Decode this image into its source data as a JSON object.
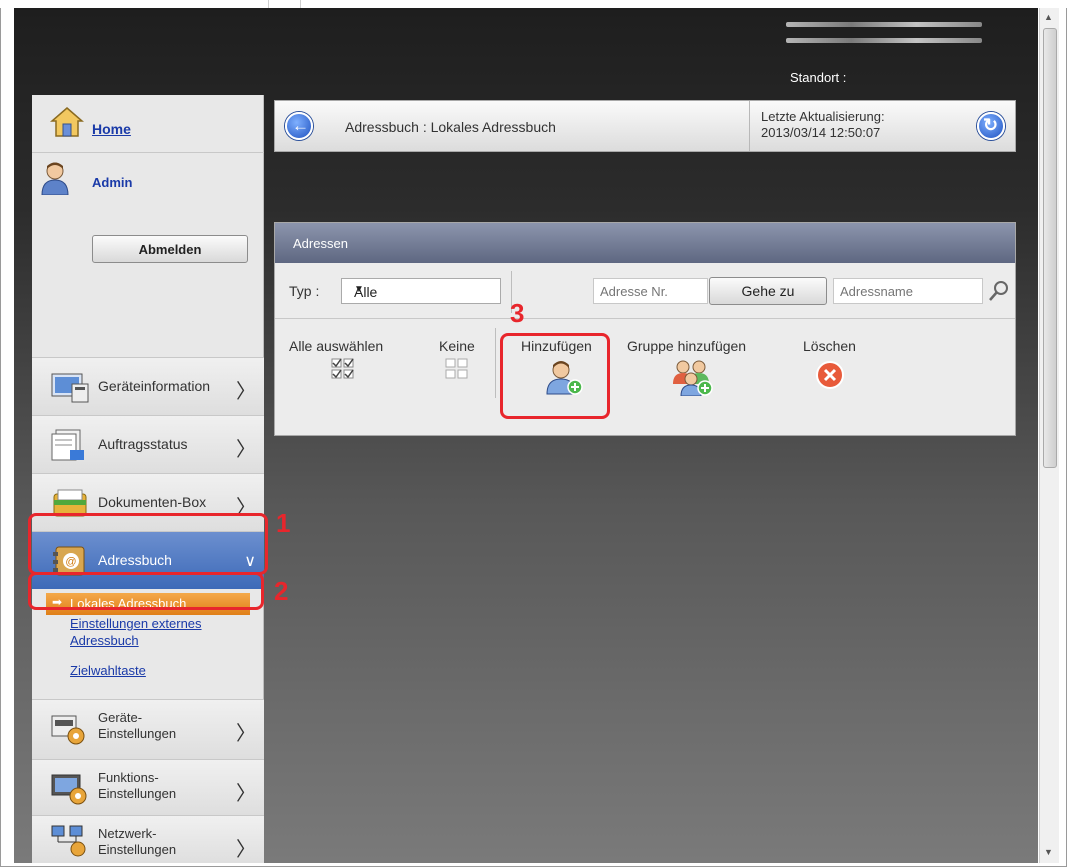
{
  "header": {
    "location_label": "Standort :"
  },
  "sidebar": {
    "home_label": "Home",
    "user_name": "Admin",
    "logout_label": "Abmelden",
    "nav": [
      {
        "label": "Geräteinformation"
      },
      {
        "label": "Auftragsstatus"
      },
      {
        "label": "Dokumenten-Box"
      },
      {
        "label": "Adressbuch"
      },
      {
        "label_line1": "Geräte-",
        "label_line2": "Einstellungen"
      },
      {
        "label_line1": "Funktions-",
        "label_line2": "Einstellungen"
      },
      {
        "label_line1": "Netzwerk-",
        "label_line2": "Einstellungen"
      }
    ],
    "sub": {
      "active": "Lokales Adressbuch",
      "external_line1": "Einstellungen externes",
      "external_line2": "Adressbuch",
      "speed_dial": "Zielwahltaste"
    }
  },
  "breadcrumb": {
    "title": "Adressbuch : Lokales Adressbuch",
    "updated_label": "Letzte Aktualisierung:",
    "updated_value": "2013/03/14 12:50:07"
  },
  "panel": {
    "title": "Adressen",
    "type_label": "Typ :",
    "type_value": "Alle",
    "address_nr_placeholder": "Adresse Nr.",
    "goto_label": "Gehe zu",
    "address_name_placeholder": "Adressname",
    "actions": {
      "select_all": "Alle auswählen",
      "none": "Keine",
      "add": "Hinzufügen",
      "add_group": "Gruppe hinzufügen",
      "delete": "Löschen"
    }
  },
  "callouts": {
    "one": "1",
    "two": "2",
    "three": "3"
  },
  "colors": {
    "callout": "#e8262c",
    "nav_active": "#3d6ab8",
    "sub_active": "#e07f18",
    "link": "#1a3aa8"
  }
}
